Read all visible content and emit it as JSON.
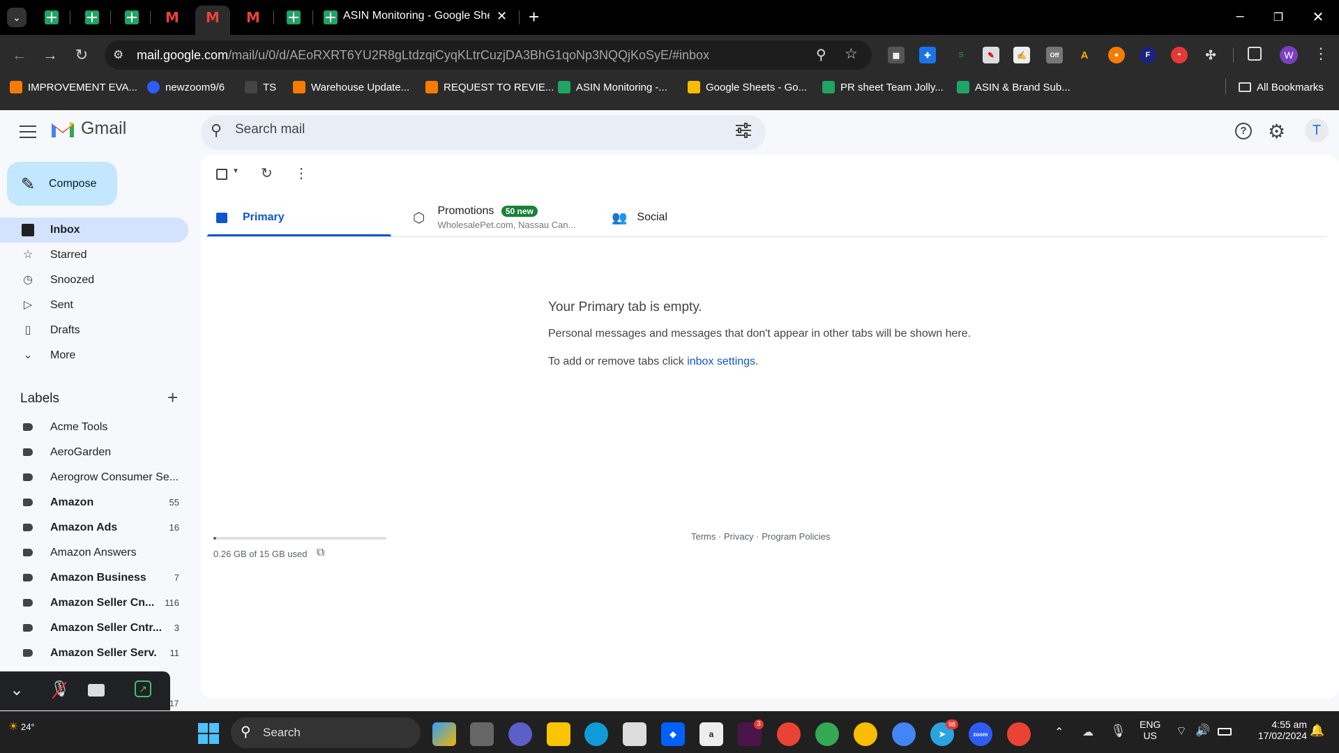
{
  "browser": {
    "active_tab_title": "ASIN Monitoring - Google Shee",
    "url_host": "mail.google.com",
    "url_path": "/mail/u/0/d/AEoRXRT6YU2R8gLtdzqiCyqKLtrCuzjDA3BhG1qoNp3NQQjKoSyE/#inbox",
    "profile_initial": "W"
  },
  "bookmarks": [
    {
      "label": "IMPROVEMENT EVA...",
      "icon": "orange-doc-icon"
    },
    {
      "label": "newzoom9/6",
      "icon": "zoom-icon"
    },
    {
      "label": "TS",
      "icon": "chart-icon"
    },
    {
      "label": "Warehouse Update...",
      "icon": "orange-doc-icon"
    },
    {
      "label": "REQUEST TO REVIE...",
      "icon": "orange-doc-icon"
    },
    {
      "label": "ASIN Monitoring -...",
      "icon": "sheets-icon"
    },
    {
      "label": "Google Sheets - Go...",
      "icon": "drive-icon"
    },
    {
      "label": "PR sheet Team Jolly...",
      "icon": "sheets-icon"
    },
    {
      "label": "ASIN & Brand Sub...",
      "icon": "sheets-icon"
    }
  ],
  "all_bookmarks": "All Bookmarks",
  "gmail": {
    "app_name": "Gmail",
    "search_placeholder": "Search mail",
    "avatar_initial": "T",
    "compose": "Compose",
    "nav": [
      "Inbox",
      "Starred",
      "Snoozed",
      "Sent",
      "Drafts",
      "More"
    ],
    "labels_heading": "Labels",
    "labels": [
      {
        "name": "Acme Tools",
        "count": "",
        "bold": false
      },
      {
        "name": "AeroGarden",
        "count": "",
        "bold": false
      },
      {
        "name": "Aerogrow Consumer Se...",
        "count": "",
        "bold": false
      },
      {
        "name": "Amazon",
        "count": "55",
        "bold": true
      },
      {
        "name": "Amazon Ads",
        "count": "16",
        "bold": true
      },
      {
        "name": "Amazon Answers",
        "count": "",
        "bold": false
      },
      {
        "name": "Amazon Business",
        "count": "7",
        "bold": true
      },
      {
        "name": "Amazon Seller Cn...",
        "count": "116",
        "bold": true
      },
      {
        "name": "Amazon Seller Cntr...",
        "count": "3",
        "bold": true
      },
      {
        "name": "Amazon Seller Serv.",
        "count": "11",
        "bold": true
      }
    ],
    "hidden_count": "17",
    "tabs": {
      "primary": "Primary",
      "promotions": "Promotions",
      "promotions_badge": "50 new",
      "promotions_sub": "WholesalePet.com, Nassau Can...",
      "social": "Social"
    },
    "empty_title": "Your Primary tab is empty.",
    "empty_desc": "Personal messages and messages that don't appear in other tabs will be shown here.",
    "empty_tabs_prefix": "To add or remove tabs click ",
    "empty_tabs_link": "inbox settings",
    "empty_tabs_suffix": ".",
    "storage": "0.26 GB of 15 GB used",
    "storage_fraction": 0.017,
    "footer_terms": "Terms",
    "footer_privacy": "Privacy",
    "footer_policies": "Program Policies",
    "footer_sep": "·"
  },
  "taskbar": {
    "weather": "24°",
    "search": "Search",
    "lang1": "ENG",
    "lang2": "US",
    "time": "4:55 am",
    "date": "17/02/2024",
    "badge_slack": "3",
    "badge_telegram": "98"
  },
  "colors": {
    "accent": "#0b57d0",
    "compose_bg": "#c2e7ff",
    "active_nav": "#d3e3fd",
    "badge": "#188038"
  }
}
